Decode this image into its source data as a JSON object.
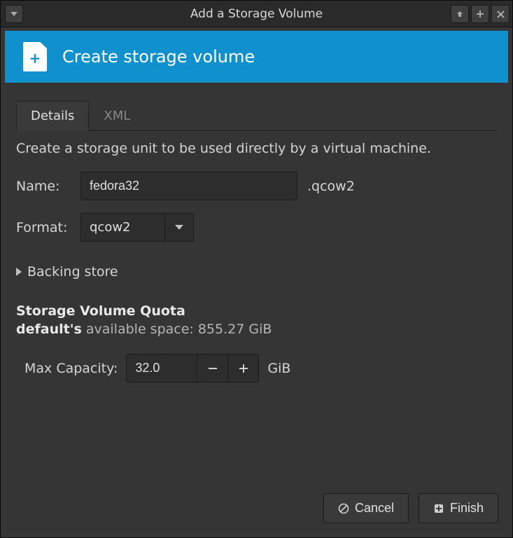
{
  "window": {
    "title": "Add a Storage Volume"
  },
  "banner": {
    "title": "Create storage volume"
  },
  "tabs": {
    "details": "Details",
    "xml": "XML"
  },
  "details": {
    "description": "Create a storage unit to be used directly by a virtual machine.",
    "name_label": "Name:",
    "name_value": "fedora32",
    "name_suffix": ".qcow2",
    "format_label": "Format:",
    "format_value": "qcow2",
    "backing_store_label": "Backing store",
    "quota_title": "Storage Volume Quota",
    "quota_pool": "default's",
    "quota_text": " available space: 855.27 GiB",
    "capacity_label": "Max Capacity:",
    "capacity_value": "32.0",
    "capacity_unit": "GiB"
  },
  "footer": {
    "cancel": "Cancel",
    "finish": "Finish"
  }
}
